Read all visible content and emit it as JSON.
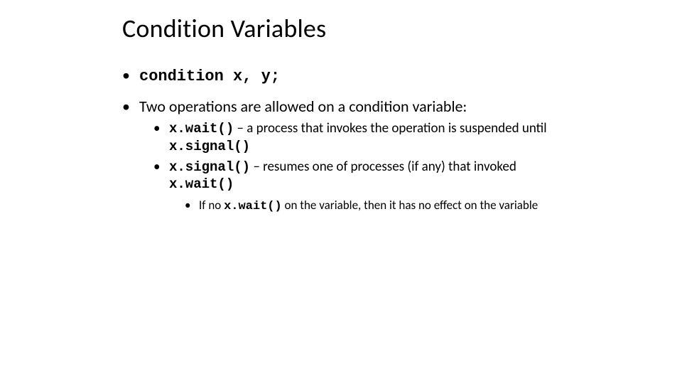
{
  "slide": {
    "title": "Condition Variables",
    "bullets": {
      "b1_code": "condition x, y;",
      "b2_text": "Two operations are allowed on a condition variable:",
      "b2_sub": {
        "s1_code": "x.wait()",
        "s1_text_a": " –  a process that invokes the operation is suspended until ",
        "s1_code_b": "x.signal()",
        "s2_code": "x.signal()",
        "s2_text_a": " – resumes one of processes (if any) that  invoked ",
        "s2_code_b": "x.wait()",
        "s2_sub": {
          "n1_a": "If no ",
          "n1_code": "x.wait()",
          "n1_b": " on the variable, then it has no effect on the variable"
        }
      }
    }
  }
}
